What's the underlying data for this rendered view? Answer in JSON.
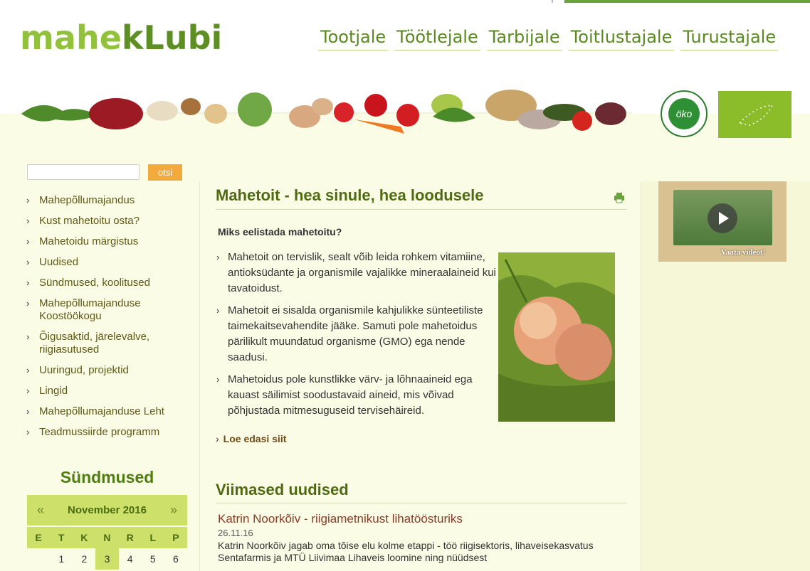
{
  "logo": {
    "part1": "mahe",
    "part2": "kLubi"
  },
  "nav": [
    "Tootjale",
    "Töötlejale",
    "Tarbijale",
    "Toitlustajale",
    "Turustajale"
  ],
  "search": {
    "button": "otsi",
    "placeholder": ""
  },
  "sidebar": {
    "items": [
      "Mahepõllumajandus",
      "Kust mahetoitu osta?",
      "Mahetoidu märgistus",
      "Uudised",
      "Sündmused, koolitused",
      "Mahepõllumajanduse Koostöökogu",
      "Õigusaktid, järelevalve, riigiasutused",
      "Uuringud, projektid",
      "Lingid",
      "Mahepõllumajanduse Leht",
      "Teadmussiirde programm"
    ]
  },
  "events": {
    "title": "Sündmused",
    "month": "November 2016",
    "prev": "«",
    "next": "»",
    "days": [
      "E",
      "T",
      "K",
      "N",
      "R",
      "L",
      "P"
    ],
    "row1": [
      "",
      "1",
      "2",
      "3",
      "4",
      "5",
      "6"
    ],
    "today": "3"
  },
  "main": {
    "title": "Mahetoit - hea sinule, hea loodusele",
    "subtitle": "Miks eelistada mahetoitu?",
    "bullets": [
      "Mahetoit on tervislik, sealt võib leida rohkem vitamiine, antioksüdante ja organismile vajalikke mineraalaineid kui tavatoidust.",
      "Mahetoit ei sisalda organismile kahjulikke sünteetiliste taimekaitsevahendite jääke. Samuti pole mahetoidus pärilikult muundatud organisme (GMO) ega nende saadusi.",
      "Mahetoidus pole kunstlikke värv- ja lõhnaaineid ega kauast säilimist soodustavaid aineid, mis võivad põhjustada mitmesuguseid tervisehäireid."
    ],
    "read_more": "Loe edasi siit"
  },
  "news": {
    "title": "Viimased uudised",
    "item_title": "Katrin Noorkõiv - riigiametnikust lihatöösturiks",
    "item_date": "26.11.16",
    "item_text": "Katrin Noorkõiv jagab oma tõise elu kolme etappi - töö riigisektoris, lihaveisekasvatus Sentafarmis ja MTÜ Liivimaa Lihaveis loomine ning nüüdsest"
  },
  "video": {
    "label": "Vaata videot!"
  },
  "badges": {
    "oko": "öko"
  },
  "colors": {
    "green": "#5a8a1f",
    "light_green": "#cde06a",
    "orange": "#f4a93b",
    "bg": "#fbfce6"
  }
}
